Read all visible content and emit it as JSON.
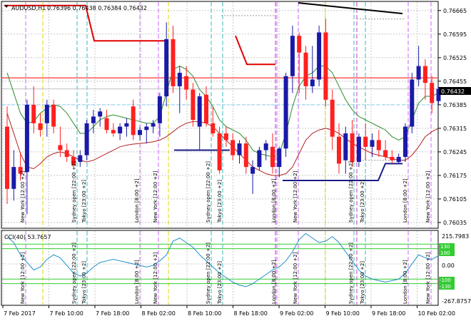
{
  "header": {
    "symbol_label": "AUDUSD,H1",
    "ohlc_label": "0.76396 0.76438 0.76384 0.76432"
  },
  "price_axis": {
    "ticks": [
      "0.76665",
      "0.76595",
      "0.76525",
      "0.76455",
      "0.76385",
      "0.76315",
      "0.76245",
      "0.76175",
      "0.76105",
      "0.76035"
    ],
    "current_price": "0.76432",
    "current_price_color": "#000000",
    "bid_line_color": "#c0c0c0",
    "ask_line_color": "#ff0000"
  },
  "cci": {
    "label": "CCI(40) 53.7657",
    "max": "215.7983",
    "zero": "0.00",
    "min": "-267.8757",
    "level_pos": "100",
    "level_pos2": "130",
    "level_neg": "-100",
    "level_neg2": "-130",
    "level_color": "#33cc33",
    "line_color": "#1e90c8"
  },
  "time_axis": {
    "labels": [
      "7 Feb 2017",
      "7 Feb 10:00",
      "7 Feb 18:00",
      "8 Feb 02:00",
      "8 Feb 10:00",
      "8 Feb 18:00",
      "9 Feb 02:00",
      "9 Feb 10:00",
      "9 Feb 18:00",
      "10 Feb 02:00"
    ]
  },
  "session_labels": [
    {
      "text": "New York  [12:00 +2]",
      "ch": 1
    },
    {
      "text": "Sydney open  [22:00 +2]",
      "ch": 5
    },
    {
      "text": "Tokyo  [23:00 +2]",
      "ch": 6
    },
    {
      "text": "London  [8:00 +2]",
      "ch": 10
    },
    {
      "text": "New York  [12:00 +2]",
      "ch": 12
    },
    {
      "text": "Sydney open  [22:00 +2]",
      "ch": 16
    },
    {
      "text": "Tokyo  [23:00 +2]",
      "ch": 17
    },
    {
      "text": "London  [8:00 +2]",
      "ch": 21
    },
    {
      "text": "New York  [12:00 +2]",
      "ch": 23
    },
    {
      "text": "Sydney open  [22:00 +2]",
      "ch": 27
    },
    {
      "text": "Tokyo  [23:00 +2]",
      "ch": 28
    },
    {
      "text": "London  [8:00 +2]",
      "ch": 32
    },
    {
      "text": "New York  [12:00 +2]",
      "ch": 34
    }
  ],
  "chart_data": {
    "type": "candlestick",
    "bull_color": "#1a1aa8",
    "bear_color": "#ff2020",
    "ma_fast_color": "#2e8b2e",
    "ma_slow_color": "#b22222",
    "candles": [
      {
        "o": 0.7632,
        "h": 0.7638,
        "l": 0.7609,
        "c": 0.76135
      },
      {
        "o": 0.76135,
        "h": 0.7625,
        "l": 0.761,
        "c": 0.762
      },
      {
        "o": 0.762,
        "h": 0.76245,
        "l": 0.7616,
        "c": 0.7618
      },
      {
        "o": 0.76185,
        "h": 0.764,
        "l": 0.7606,
        "c": 0.76385
      },
      {
        "o": 0.76385,
        "h": 0.7644,
        "l": 0.763,
        "c": 0.7633
      },
      {
        "o": 0.7633,
        "h": 0.7636,
        "l": 0.7629,
        "c": 0.7631
      },
      {
        "o": 0.7633,
        "h": 0.764,
        "l": 0.7629,
        "c": 0.76385
      },
      {
        "o": 0.76385,
        "h": 0.764,
        "l": 0.763,
        "c": 0.7632
      },
      {
        "o": 0.76265,
        "h": 0.7632,
        "l": 0.7623,
        "c": 0.7625
      },
      {
        "o": 0.7625,
        "h": 0.7627,
        "l": 0.76215,
        "c": 0.7623
      },
      {
        "o": 0.7623,
        "h": 0.7625,
        "l": 0.762,
        "c": 0.76205
      },
      {
        "o": 0.76215,
        "h": 0.7625,
        "l": 0.762,
        "c": 0.76235
      },
      {
        "o": 0.76235,
        "h": 0.7634,
        "l": 0.7622,
        "c": 0.7633
      },
      {
        "o": 0.7633,
        "h": 0.7637,
        "l": 0.763,
        "c": 0.7635
      },
      {
        "o": 0.7635,
        "h": 0.76375,
        "l": 0.7632,
        "c": 0.76365
      },
      {
        "o": 0.76345,
        "h": 0.7637,
        "l": 0.763,
        "c": 0.7631
      },
      {
        "o": 0.7631,
        "h": 0.7633,
        "l": 0.7629,
        "c": 0.763
      },
      {
        "o": 0.763,
        "h": 0.7633,
        "l": 0.7628,
        "c": 0.7632
      },
      {
        "o": 0.7632,
        "h": 0.76345,
        "l": 0.7629,
        "c": 0.7633
      },
      {
        "o": 0.7638,
        "h": 0.764,
        "l": 0.7628,
        "c": 0.76295
      },
      {
        "o": 0.76295,
        "h": 0.7632,
        "l": 0.7628,
        "c": 0.7631
      },
      {
        "o": 0.7631,
        "h": 0.7633,
        "l": 0.7627,
        "c": 0.7632
      },
      {
        "o": 0.7632,
        "h": 0.7634,
        "l": 0.763,
        "c": 0.7633
      },
      {
        "o": 0.7633,
        "h": 0.7642,
        "l": 0.7629,
        "c": 0.7641
      },
      {
        "o": 0.7641,
        "h": 0.7663,
        "l": 0.7638,
        "c": 0.7658
      },
      {
        "o": 0.7658,
        "h": 0.7662,
        "l": 0.7642,
        "c": 0.7644
      },
      {
        "o": 0.7644,
        "h": 0.765,
        "l": 0.7636,
        "c": 0.7648
      },
      {
        "o": 0.7647,
        "h": 0.765,
        "l": 0.764,
        "c": 0.7643
      },
      {
        "o": 0.7643,
        "h": 0.7645,
        "l": 0.7632,
        "c": 0.7634
      },
      {
        "o": 0.7632,
        "h": 0.7642,
        "l": 0.7625,
        "c": 0.7641
      },
      {
        "o": 0.76415,
        "h": 0.7644,
        "l": 0.7632,
        "c": 0.7633
      },
      {
        "o": 0.7633,
        "h": 0.7638,
        "l": 0.7629,
        "c": 0.763
      },
      {
        "o": 0.763,
        "h": 0.7632,
        "l": 0.7618,
        "c": 0.7619
      },
      {
        "o": 0.763,
        "h": 0.7632,
        "l": 0.7626,
        "c": 0.7628
      },
      {
        "o": 0.7628,
        "h": 0.763,
        "l": 0.7622,
        "c": 0.76235
      },
      {
        "o": 0.76235,
        "h": 0.7628,
        "l": 0.7621,
        "c": 0.7627
      },
      {
        "o": 0.7627,
        "h": 0.7629,
        "l": 0.7618,
        "c": 0.762
      },
      {
        "o": 0.7618,
        "h": 0.7622,
        "l": 0.7612,
        "c": 0.762
      },
      {
        "o": 0.762,
        "h": 0.7626,
        "l": 0.7619,
        "c": 0.7625
      },
      {
        "o": 0.7625,
        "h": 0.7628,
        "l": 0.7622,
        "c": 0.7627
      },
      {
        "o": 0.7626,
        "h": 0.763,
        "l": 0.7618,
        "c": 0.762
      },
      {
        "o": 0.762,
        "h": 0.7626,
        "l": 0.7617,
        "c": 0.76255
      },
      {
        "o": 0.76255,
        "h": 0.7648,
        "l": 0.7623,
        "c": 0.7647
      },
      {
        "o": 0.7647,
        "h": 0.7662,
        "l": 0.7642,
        "c": 0.7659
      },
      {
        "o": 0.7659,
        "h": 0.766,
        "l": 0.7642,
        "c": 0.7654
      },
      {
        "o": 0.7654,
        "h": 0.7656,
        "l": 0.764,
        "c": 0.7644
      },
      {
        "o": 0.7644,
        "h": 0.7656,
        "l": 0.7642,
        "c": 0.7646
      },
      {
        "o": 0.7646,
        "h": 0.7662,
        "l": 0.7644,
        "c": 0.766
      },
      {
        "o": 0.766,
        "h": 0.7664,
        "l": 0.7638,
        "c": 0.764
      },
      {
        "o": 0.764,
        "h": 0.7643,
        "l": 0.7625,
        "c": 0.7629
      },
      {
        "o": 0.7629,
        "h": 0.7633,
        "l": 0.7618,
        "c": 0.7621
      },
      {
        "o": 0.7622,
        "h": 0.7632,
        "l": 0.7618,
        "c": 0.763
      },
      {
        "o": 0.763,
        "h": 0.7634,
        "l": 0.762,
        "c": 0.76215
      },
      {
        "o": 0.76215,
        "h": 0.763,
        "l": 0.762,
        "c": 0.7629
      },
      {
        "o": 0.7629,
        "h": 0.7633,
        "l": 0.7622,
        "c": 0.7626
      },
      {
        "o": 0.7626,
        "h": 0.763,
        "l": 0.7623,
        "c": 0.7628
      },
      {
        "o": 0.7628,
        "h": 0.7631,
        "l": 0.7623,
        "c": 0.7625
      },
      {
        "o": 0.7625,
        "h": 0.7628,
        "l": 0.7622,
        "c": 0.7623
      },
      {
        "o": 0.7623,
        "h": 0.7625,
        "l": 0.7621,
        "c": 0.7622
      },
      {
        "o": 0.76215,
        "h": 0.7624,
        "l": 0.7621,
        "c": 0.7623
      },
      {
        "o": 0.7623,
        "h": 0.7633,
        "l": 0.76215,
        "c": 0.7632
      },
      {
        "o": 0.7632,
        "h": 0.7648,
        "l": 0.763,
        "c": 0.7646
      },
      {
        "o": 0.7646,
        "h": 0.7656,
        "l": 0.7644,
        "c": 0.765
      },
      {
        "o": 0.765,
        "h": 0.7652,
        "l": 0.764,
        "c": 0.7645
      },
      {
        "o": 0.7645,
        "h": 0.7647,
        "l": 0.7636,
        "c": 0.7639
      },
      {
        "o": 0.76396,
        "h": 0.76438,
        "l": 0.76384,
        "c": 0.76432
      }
    ],
    "ma_fast": [
      0.7648,
      0.7642,
      0.7636,
      0.7633,
      0.76335,
      0.7636,
      0.76375,
      0.76385,
      0.7638,
      0.7636,
      0.7633,
      0.763,
      0.763,
      0.7632,
      0.7634,
      0.7635,
      0.76355,
      0.7635,
      0.76345,
      0.7634,
      0.76335,
      0.7633,
      0.7633,
      0.7635,
      0.7642,
      0.7649,
      0.765,
      0.7649,
      0.7647,
      0.7643,
      0.7641,
      0.7638,
      0.7634,
      0.7632,
      0.7631,
      0.763,
      0.7628,
      0.7625,
      0.7624,
      0.76235,
      0.7623,
      0.7624,
      0.763,
      0.7638,
      0.7644,
      0.7647,
      0.7648,
      0.765,
      0.765,
      0.7648,
      0.7644,
      0.764,
      0.7637,
      0.7635,
      0.7634,
      0.7633,
      0.7632,
      0.7631,
      0.7629,
      0.7628,
      0.7629,
      0.7634,
      0.7639,
      0.7641,
      0.7641,
      0.7642
    ],
    "ma_slow": [
      0.7636,
      0.763,
      0.7624,
      0.762,
      0.76195,
      0.7621,
      0.7623,
      0.7624,
      0.76245,
      0.7624,
      0.7623,
      0.7622,
      0.76215,
      0.7622,
      0.7623,
      0.7624,
      0.7625,
      0.7626,
      0.76265,
      0.76268,
      0.7627,
      0.76272,
      0.76275,
      0.7628,
      0.7629,
      0.76305,
      0.7632,
      0.7633,
      0.76335,
      0.76335,
      0.7633,
      0.7632,
      0.763,
      0.7628,
      0.7626,
      0.7624,
      0.7622,
      0.762,
      0.7619,
      0.7618,
      0.76175,
      0.76175,
      0.7618,
      0.762,
      0.7624,
      0.7628,
      0.763,
      0.7631,
      0.76315,
      0.7631,
      0.763,
      0.76285,
      0.7627,
      0.7626,
      0.7625,
      0.7624,
      0.76235,
      0.7623,
      0.76225,
      0.7622,
      0.7622,
      0.76235,
      0.7626,
      0.7629,
      0.76305,
      0.76315
    ],
    "cci_values": [
      180,
      140,
      60,
      10,
      -40,
      -20,
      30,
      60,
      40,
      -10,
      -60,
      -80,
      -60,
      -20,
      10,
      20,
      30,
      20,
      10,
      0,
      -10,
      -20,
      -10,
      20,
      60,
      150,
      170,
      140,
      110,
      60,
      20,
      -20,
      -60,
      -90,
      -120,
      -140,
      -150,
      -130,
      -100,
      -70,
      -40,
      -20,
      20,
      80,
      160,
      200,
      170,
      140,
      150,
      180,
      140,
      80,
      20,
      -40,
      -80,
      -100,
      -110,
      -120,
      -110,
      -100,
      -60,
      0,
      60,
      40,
      30,
      54
    ]
  }
}
